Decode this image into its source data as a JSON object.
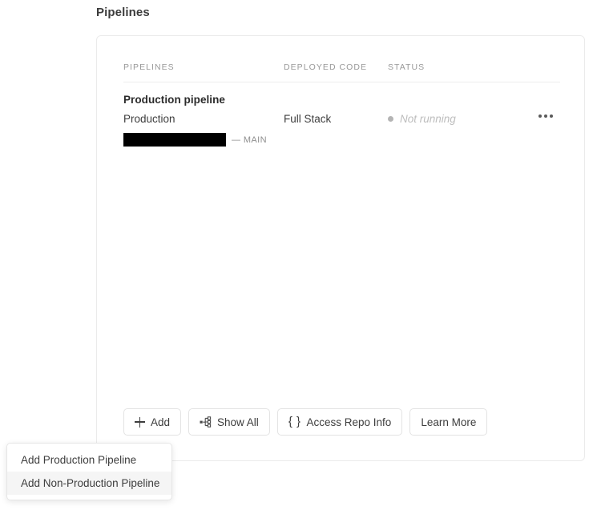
{
  "page": {
    "title": "Pipelines"
  },
  "table": {
    "headers": {
      "pipelines": "PIPELINES",
      "deployed_code": "DEPLOYED CODE",
      "status": "STATUS"
    },
    "rows": [
      {
        "name": "Production pipeline",
        "environment": "Production",
        "deployed_code": "Full Stack",
        "status_text": "Not running",
        "status_color": "#b4b4b4",
        "repo_name": "",
        "repo_redacted": true,
        "branch": "— MAIN",
        "menu_icon": "ellipsis-icon"
      }
    ]
  },
  "actions": [
    {
      "label": "Add",
      "icon": "plus-icon"
    },
    {
      "label": "Show All",
      "icon": "tree-icon"
    },
    {
      "label": "Access Repo Info",
      "icon": "braces-icon",
      "glyph": "{ }"
    },
    {
      "label": "Learn More",
      "icon": ""
    }
  ],
  "dropdown": {
    "items": [
      {
        "label": "Add Production Pipeline",
        "active": false
      },
      {
        "label": "Add Non-Production Pipeline",
        "active": true
      }
    ]
  }
}
